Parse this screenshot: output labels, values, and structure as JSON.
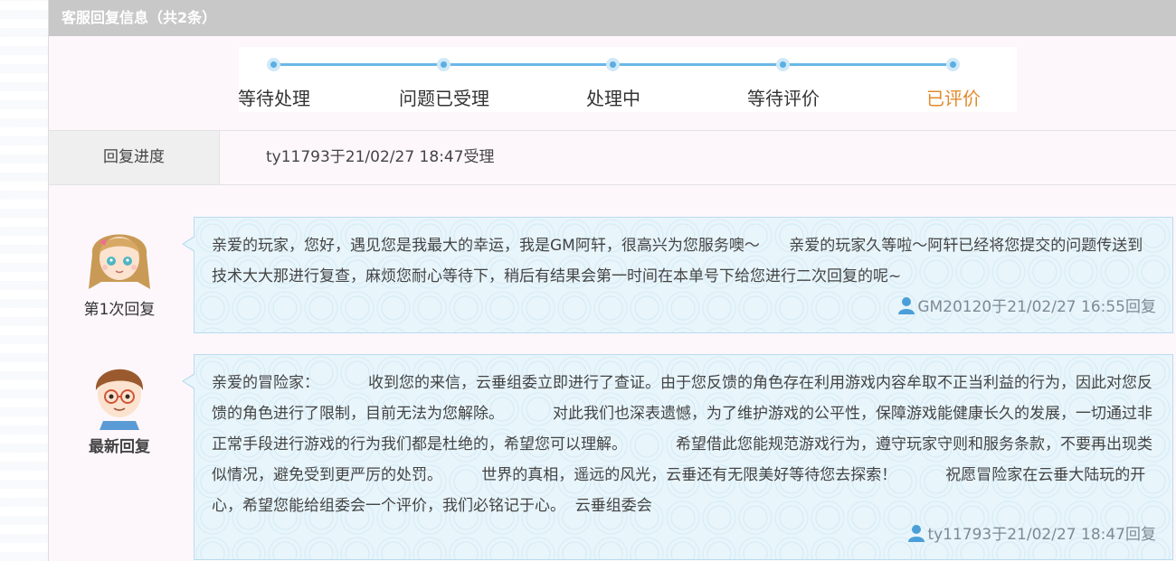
{
  "header": {
    "title": "客服回复信息（共2条）"
  },
  "progress": {
    "steps": [
      {
        "label": "等待处理"
      },
      {
        "label": "问题已受理"
      },
      {
        "label": "处理中"
      },
      {
        "label": "等待评价"
      },
      {
        "label": "已评价"
      }
    ],
    "current_index": 4,
    "colors": {
      "track": "#6bb7e8",
      "active_label": "#e08a2c"
    }
  },
  "status_row": {
    "label": "回复进度",
    "value": "ty11793于21/02/27 18:47受理"
  },
  "replies": [
    {
      "avatar_icon": "girl-avatar-icon",
      "caption": "第1次回复",
      "text": "亲爱的玩家，您好，遇见您是我最大的幸运，我是GM阿轩，很高兴为您服务噢～      亲爱的玩家久等啦～阿轩已经将您提交的问题传送到技术大大那进行复查，麻烦您耐心等待下，稍后有结果会第一时间在本单号下给您进行二次回复的呢~",
      "meta": "GM20120于21/02/27 16:55回复"
    },
    {
      "avatar_icon": "boy-avatar-icon",
      "caption": "最新回复",
      "text": "亲爱的冒险家：          收到您的来信，云垂组委立即进行了查证。由于您反馈的角色存在利用游戏内容牟取不正当利益的行为，因此对您反馈的角色进行了限制，目前无法为您解除。          对此我们也深表遗憾，为了维护游戏的公平性，保障游戏能健康长久的发展，一切通过非正常手段进行游戏的行为我们都是杜绝的，希望您可以理解。          希望借此您能规范游戏行为，遵守玩家守则和服务条款，不要再出现类似情况，避免受到更严厉的处罚。        世界的真相，遥远的风光，云垂还有无限美好等待您去探索！          祝愿冒险家在云垂大陆玩的开心，希望您能给组委会一个评价，我们必铭记于心。  云垂组委会",
      "meta": "ty11793于21/02/27 18:47回复"
    }
  ]
}
